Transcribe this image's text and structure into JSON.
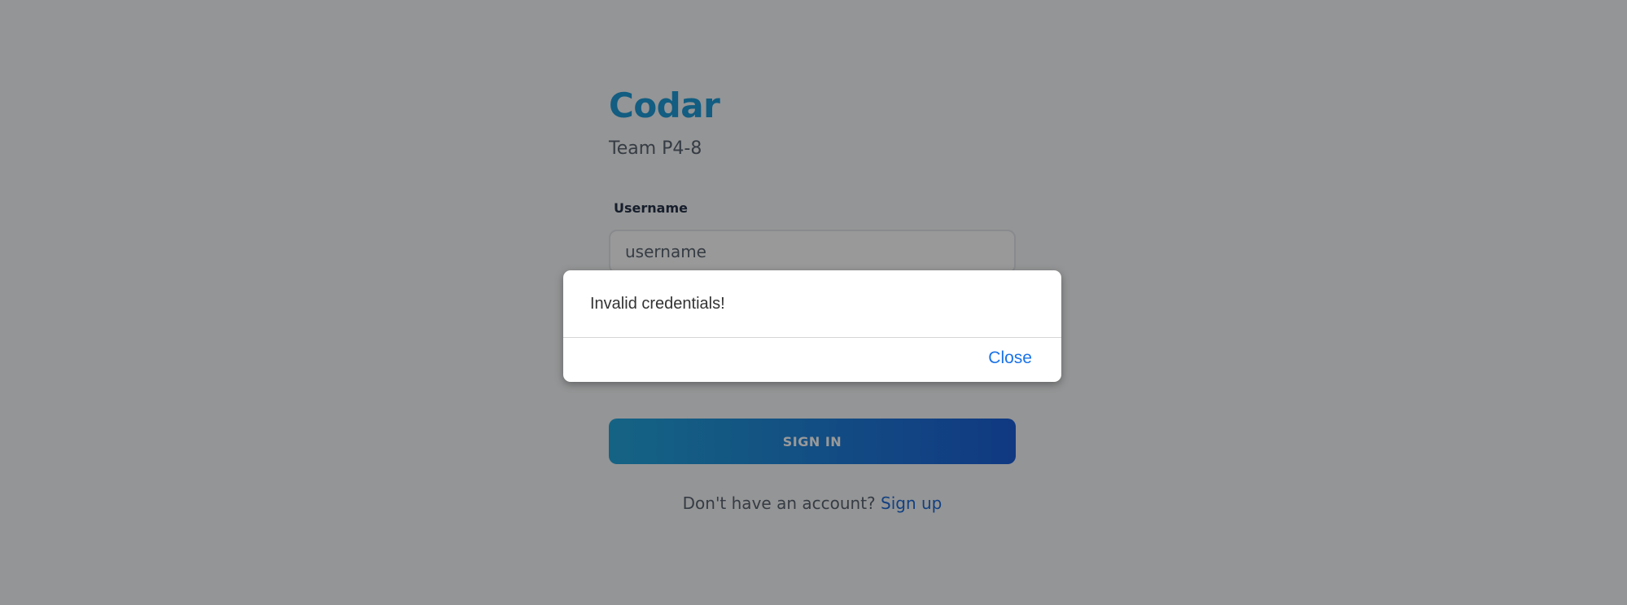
{
  "app": {
    "title": "Codar",
    "subtitle": "Team P4-8"
  },
  "login_form": {
    "username_label": "Username",
    "username_placeholder": "username",
    "username_value": "",
    "signin_label": "SIGN IN",
    "signup_prompt": "Don't have an account?",
    "signup_link": "Sign up"
  },
  "dialog": {
    "message": "Invalid credentials!",
    "close_label": "Close"
  },
  "colors": {
    "brand": "#1e9bd8",
    "button_gradient_start": "#23a6dc",
    "button_gradient_end": "#1c5fd9",
    "link": "#1e6cd8",
    "dialog_action": "#1a73e8",
    "overlay": "rgba(0,0,0,0.4)"
  }
}
